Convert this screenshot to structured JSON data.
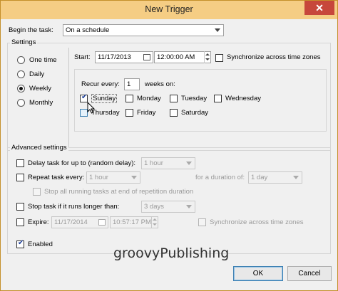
{
  "window": {
    "title": "New Trigger",
    "close_label": "✕"
  },
  "begin": {
    "label": "Begin the task:",
    "value": "On a schedule"
  },
  "settings": {
    "group_label": "Settings",
    "radios": [
      "One time",
      "Daily",
      "Weekly",
      "Monthly"
    ],
    "selected": "Weekly",
    "start_label": "Start:",
    "start_date": "11/17/2013",
    "start_time": "12:00:00 AM",
    "sync_label": "Synchronize across time zones",
    "recur_label": "Recur every:",
    "recur_value": "1",
    "weeks_label": "weeks on:",
    "days": [
      {
        "label": "Sunday",
        "checked": true
      },
      {
        "label": "Monday",
        "checked": false
      },
      {
        "label": "Tuesday",
        "checked": false
      },
      {
        "label": "Wednesday",
        "checked": false
      },
      {
        "label": "Thursday",
        "checked": false
      },
      {
        "label": "Friday",
        "checked": false
      },
      {
        "label": "Saturday",
        "checked": false
      }
    ]
  },
  "advanced": {
    "group_label": "Advanced settings",
    "delay_label": "Delay task for up to (random delay):",
    "delay_value": "1 hour",
    "repeat_label": "Repeat task every:",
    "repeat_value": "1 hour",
    "duration_label": "for a duration of:",
    "duration_value": "1 day",
    "stop_all_label": "Stop all running tasks at end of repetition duration",
    "stop_if_label": "Stop task if it runs longer than:",
    "stop_if_value": "3 days",
    "expire_label": "Expire:",
    "expire_date": "11/17/2014",
    "expire_time": "10:57:17 PM",
    "expire_sync_label": "Synchronize across time zones",
    "enabled_label": "Enabled",
    "enabled_checked": true
  },
  "footer": {
    "watermark": "groovyPublishing",
    "ok_label": "OK",
    "cancel_label": "Cancel"
  }
}
